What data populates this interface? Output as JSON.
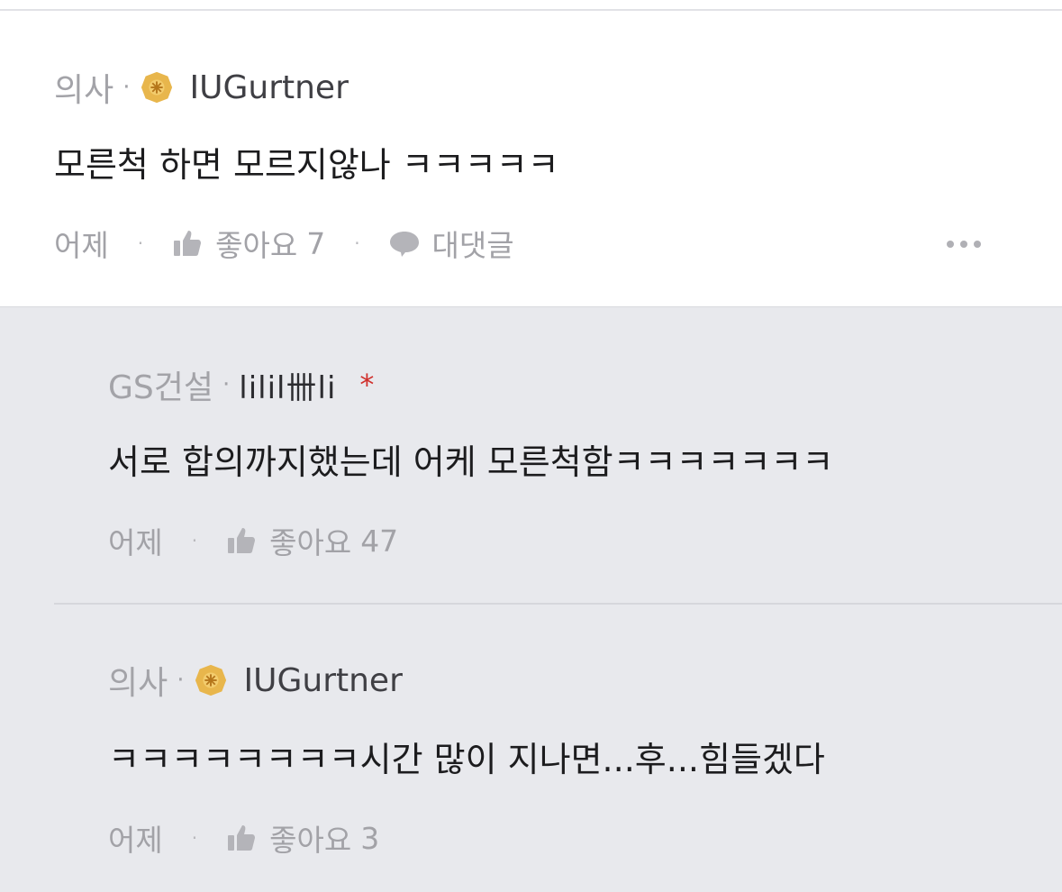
{
  "comment": {
    "job": "의사",
    "nickname": "IUGurtner",
    "text": "모른척 하면 모르지않나 ㅋㅋㅋㅋㅋ",
    "time": "어제",
    "like_label": "좋아요",
    "like_count": "7",
    "reply_label": "대댓글"
  },
  "replies": [
    {
      "job": "GS건설",
      "nickname": "lilil卌li",
      "marker": "*",
      "text": "서로 합의까지했는데 어케 모른척함ㅋㅋㅋㅋㅋㅋㅋ",
      "time": "어제",
      "like_label": "좋아요",
      "like_count": "47"
    },
    {
      "job": "의사",
      "nickname": "IUGurtner",
      "text": "ㅋㅋㅋㅋㅋㅋㅋㅋ시간 많이 지나면...후...힘들겠다",
      "time": "어제",
      "like_label": "좋아요",
      "like_count": "3"
    }
  ],
  "icons": {
    "badge": "doctor-badge-icon",
    "like": "thumbs-up-icon",
    "reply": "speech-bubble-icon",
    "more": "more-dots-icon"
  },
  "colors": {
    "reply_background": "#e8e9ed",
    "badge": "#e8b64c",
    "marker": "#d0312d"
  }
}
